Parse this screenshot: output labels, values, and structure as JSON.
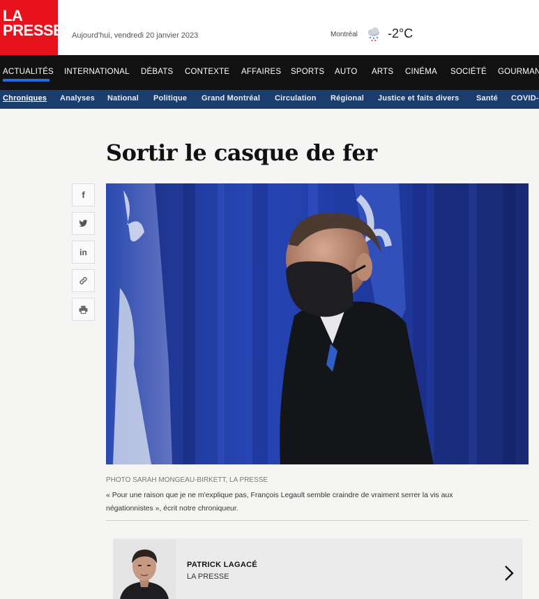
{
  "header": {
    "logo_line1": "LA",
    "logo_line2": "PRESSE",
    "date": "Aujourd'hui, vendredi 20 janvier 2023",
    "city": "Montréal",
    "temperature": "-2°C",
    "weather_icon": "snow-cloud-icon"
  },
  "main_nav": {
    "items": [
      "ACTUALITÉS",
      "INTERNATIONAL",
      "DÉBATS",
      "CONTEXTE",
      "AFFAIRES",
      "SPORTS",
      "AUTO",
      "ARTS",
      "CINÉMA",
      "SOCIÉTÉ",
      "GOURMAND"
    ],
    "active": "ACTUALITÉS"
  },
  "sub_nav": {
    "items": [
      "Chroniques",
      "Analyses",
      "National",
      "Politique",
      "Grand Montréal",
      "Circulation",
      "Régional",
      "Justice et faits divers",
      "Santé",
      "COVID-"
    ],
    "current": "Chroniques"
  },
  "article": {
    "headline": "Sortir le casque de fer",
    "photo_credit": "PHOTO SARAH MONGEAU-BIRKETT, LA PRESSE",
    "caption_line1": "« Pour une raison que je ne m'explique pas, François Legault semble craindre de vraiment serrer la vis aux",
    "caption_line2": "négationnistes », écrit notre chroniqueur."
  },
  "share_buttons": [
    {
      "icon": "facebook-icon",
      "glyph": "f"
    },
    {
      "icon": "twitter-icon",
      "glyph": ""
    },
    {
      "icon": "linkedin-icon",
      "glyph": "in"
    },
    {
      "icon": "link-icon",
      "glyph": ""
    },
    {
      "icon": "print-icon",
      "glyph": ""
    }
  ],
  "author": {
    "name": "PATRICK LAGACÉ",
    "organization": "LA PRESSE"
  },
  "colors": {
    "brand_red": "#e8121d",
    "nav_black": "#111111",
    "subnav_blue": "#1a3d6e",
    "active_underline": "#2a6bd8"
  }
}
